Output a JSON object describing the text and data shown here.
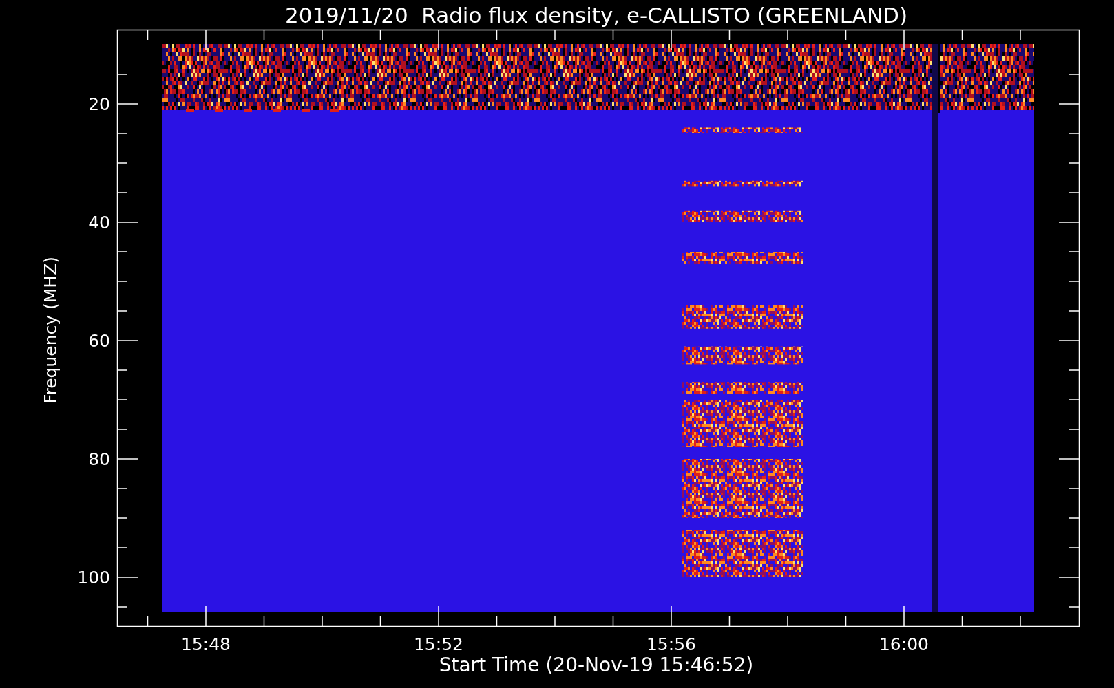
{
  "title": "2019/11/20  Radio flux density, e-CALLISTO (GREENLAND)",
  "ylabel": "Frequency (MHZ)",
  "xlabel": "Start Time (20-Nov-19 15:46:52)",
  "y_tick_labels": [
    "20",
    "40",
    "60",
    "80",
    "100"
  ],
  "x_tick_labels": [
    "15:48",
    "15:52",
    "15:56",
    "16:00"
  ]
}
